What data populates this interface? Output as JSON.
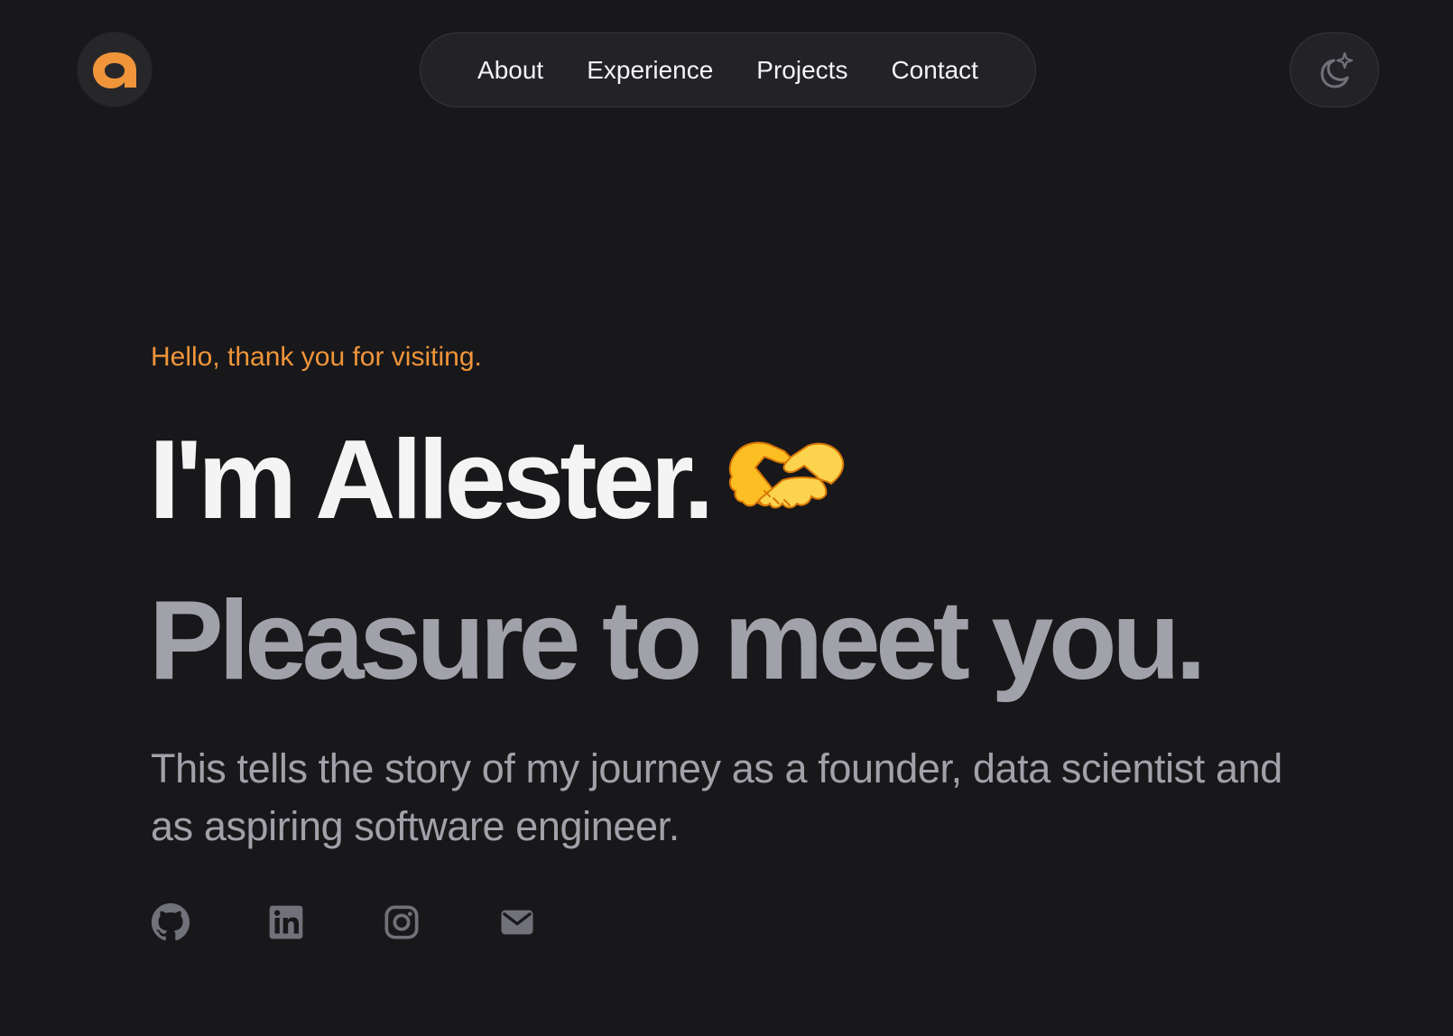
{
  "colors": {
    "background": "#18181b",
    "accent": "#f0953a",
    "heading": "#f4f4f5",
    "muted": "#a1a1aa"
  },
  "header": {
    "logo_letter": "a",
    "nav": [
      {
        "label": "About"
      },
      {
        "label": "Experience"
      },
      {
        "label": "Projects"
      },
      {
        "label": "Contact"
      }
    ],
    "theme_toggle_icon": "moon-sparkle-icon"
  },
  "hero": {
    "greeting": "Hello, thank you for visiting.",
    "title_line1": "I'm Allester.",
    "title_emoji": "handshake-icon",
    "title_line2": "Pleasure to meet you.",
    "intro": "This tells the story of my journey as a founder, data scientist and as aspiring software engineer.",
    "socials": [
      {
        "icon": "github-icon"
      },
      {
        "icon": "linkedin-icon"
      },
      {
        "icon": "instagram-icon"
      },
      {
        "icon": "mail-icon"
      }
    ]
  }
}
